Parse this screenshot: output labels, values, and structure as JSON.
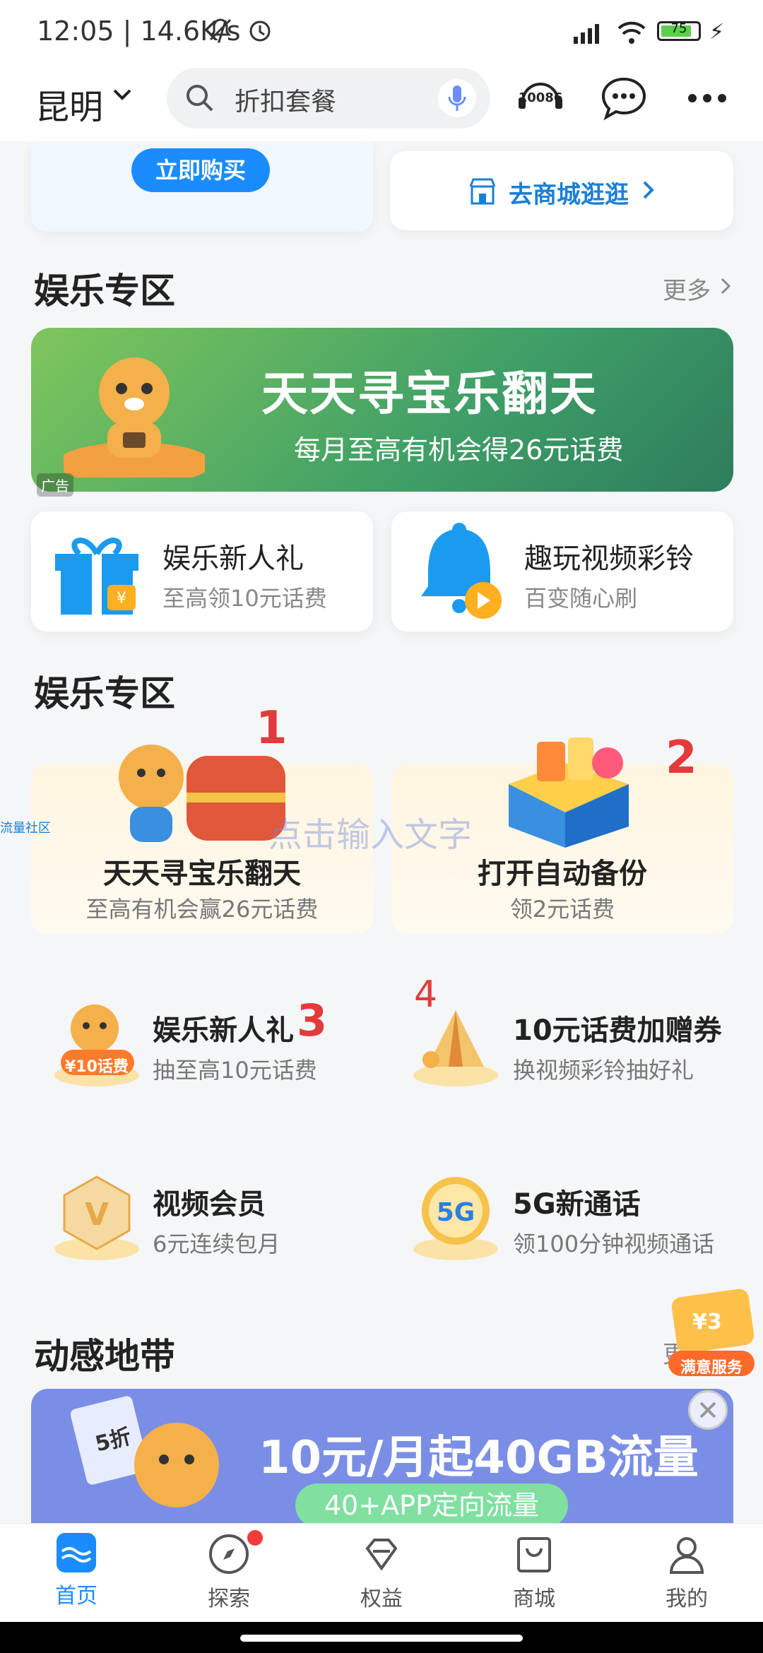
{
  "status_bar": {
    "time": "12:05 | 14.6K/s",
    "right_text": "HD  ⁿ  ⊙  75 ⚡",
    "battery": "75"
  },
  "header": {
    "city": "昆明",
    "search_placeholder": "折扣套餐",
    "icons": [
      "service-10086-icon",
      "message-icon",
      "more-icon"
    ],
    "service_label": "10086"
  },
  "promo": {
    "buy_button": "立即购买",
    "mall_link": "去商城逛逛"
  },
  "entertainment": {
    "title": "娱乐专区",
    "more": "更多",
    "banner": {
      "title": "天天寻宝乐翻天",
      "subtitle": "每月至高有机会得26元话费",
      "ad": "广告"
    },
    "cards": [
      {
        "title": "娱乐新人礼",
        "sub": "至高领10元话费"
      },
      {
        "title": "趣玩视频彩铃",
        "sub": "百变随心刷"
      }
    ]
  },
  "entertainment2": {
    "title": "娱乐专区",
    "big_tiles": [
      {
        "title": "天天寻宝乐翻天",
        "sub": "至高有机会赢26元话费",
        "mark": "1"
      },
      {
        "title": "打开自动备份",
        "sub": "领2元话费",
        "mark": "2"
      }
    ],
    "overlay_text": "点击输入文字",
    "side_tag": "流量社区",
    "grid": [
      {
        "title": "娱乐新人礼",
        "sub": "抽至高10元话费",
        "mark": "3",
        "badge": "¥10话费"
      },
      {
        "title": "10元话费加赠券",
        "sub": "换视频彩铃抽好礼",
        "mark": "4"
      },
      {
        "title": "视频会员",
        "sub": "6元连续包月"
      },
      {
        "title": "5G新通话",
        "sub": "领100分钟视频通话"
      }
    ]
  },
  "dynamic_zone": {
    "title": "动感地带",
    "more_fragment": "更",
    "banner": {
      "headline": "10元/月起40GB流量",
      "pill": "40+APP定向流量",
      "discount": "5折"
    },
    "floating": {
      "amount": "¥3",
      "label": "满意服务"
    }
  },
  "bottom_nav": [
    {
      "label": "首页",
      "active": true
    },
    {
      "label": "探索",
      "dot": true
    },
    {
      "label": "权益"
    },
    {
      "label": "商城"
    },
    {
      "label": "我的"
    }
  ],
  "colors": {
    "primary": "#1a8cff",
    "accent_red": "#e23b3b",
    "link_blue": "#1a7fd6"
  }
}
